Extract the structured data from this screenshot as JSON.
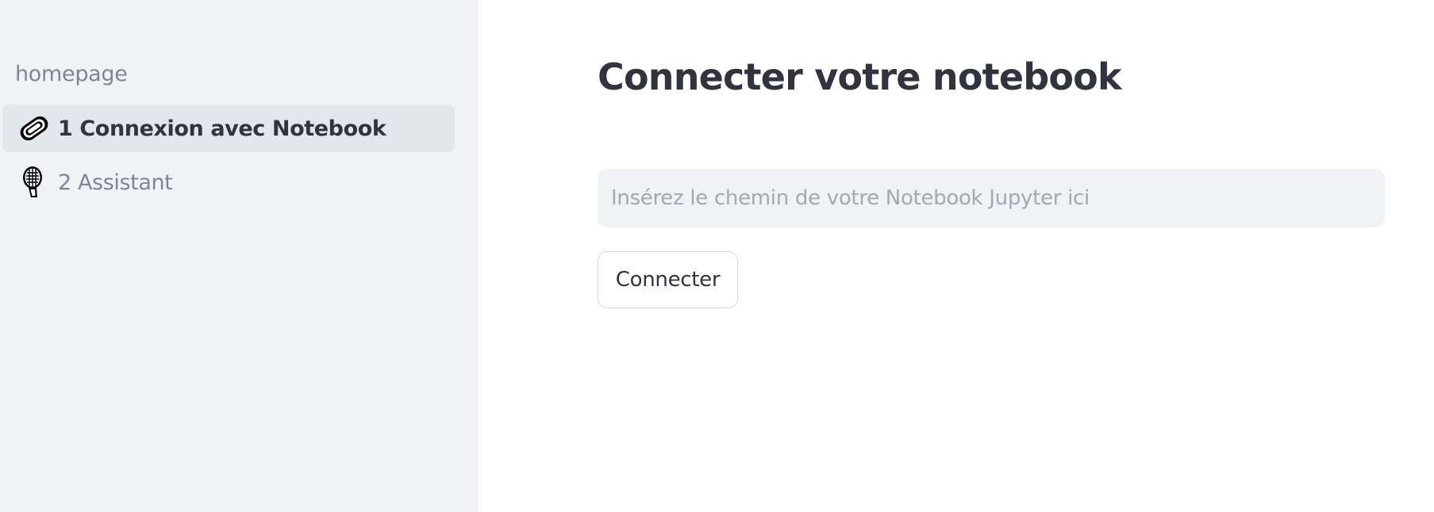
{
  "sidebar": {
    "heading": "homepage",
    "items": [
      {
        "label": "1 Connexion avec Notebook",
        "icon": "paperclip-icon",
        "active": true
      },
      {
        "label": "2 Assistant",
        "icon": "microphone-icon",
        "active": false
      }
    ]
  },
  "main": {
    "title": "Connecter votre notebook",
    "input": {
      "placeholder": "Insérez le chemin de votre Notebook Jupyter ici",
      "value": ""
    },
    "button_label": "Connecter"
  },
  "colors": {
    "sidebar_background": "#f0f2f6",
    "active_item_background": "#e2e6ed",
    "text_primary": "#31333f",
    "text_muted": "#808495"
  }
}
